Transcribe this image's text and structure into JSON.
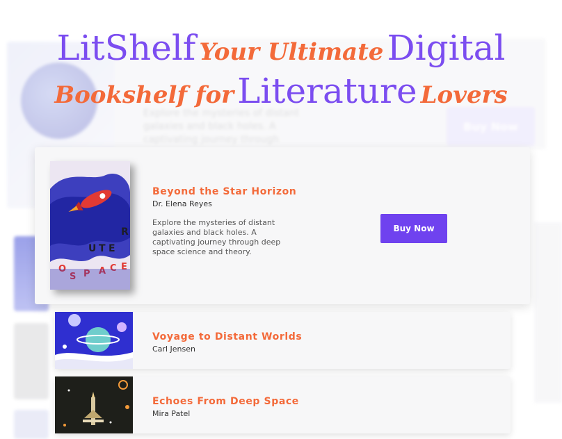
{
  "headline": {
    "brand": "LitShelf",
    "tag1": "Your Ultimate",
    "word1": "Digital",
    "tag2": "Bookshelf for",
    "word2": "Literature",
    "tag3": "Lovers"
  },
  "background_preview": {
    "description": "Explore the mysteries of distant galaxies and black holes. A captivating journey through",
    "buy_label": "Buy Now"
  },
  "featured_book": {
    "title": "Beyond the Star Horizon",
    "author": "Dr. Elena Reyes",
    "description": "Explore the mysteries of distant galaxies and black holes. A captivating journey through deep space science and theory.",
    "buy_label": "Buy Now",
    "cover_lettering": "OUTER SPACE"
  },
  "book_list": [
    {
      "title": "Voyage to Distant Worlds",
      "author": "Carl Jensen"
    },
    {
      "title": "Echoes From Deep Space",
      "author": "Mira Patel"
    }
  ],
  "colors": {
    "accent_purple": "#6f42ef",
    "accent_orange": "#f36a3a"
  }
}
